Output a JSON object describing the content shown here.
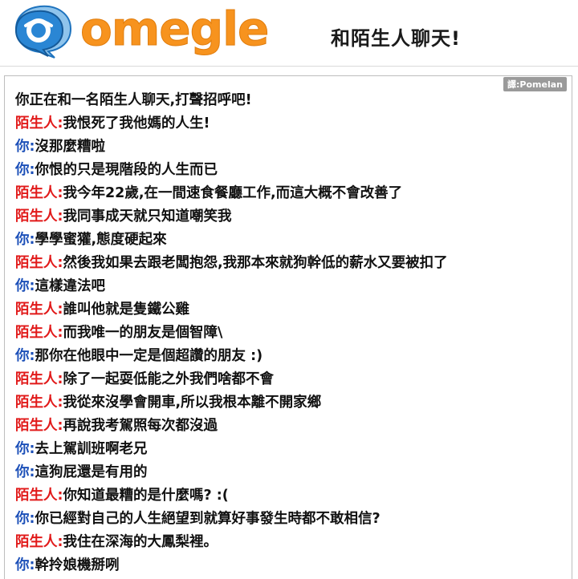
{
  "header": {
    "logo_text": "omegle",
    "tagline": "和陌生人聊天!"
  },
  "watermark": "譯:Pomelan",
  "chat": {
    "system_message": "你正在和一名陌生人聊天,打聲招呼吧!",
    "messages": [
      {
        "speaker": "陌生人:",
        "role": "stranger",
        "text": "我恨死了我他媽的人生!"
      },
      {
        "speaker": "你:",
        "role": "you",
        "text": "沒那麼糟啦"
      },
      {
        "speaker": "你:",
        "role": "you",
        "text": "你恨的只是現階段的人生而已"
      },
      {
        "speaker": "陌生人:",
        "role": "stranger",
        "text": "我今年22歲,在一間速食餐廳工作,而這大概不會改善了"
      },
      {
        "speaker": "陌生人:",
        "role": "stranger",
        "text": "我同事成天就只知道嘲笑我"
      },
      {
        "speaker": "你:",
        "role": "you",
        "text": "學學蜜獾,態度硬起來"
      },
      {
        "speaker": "陌生人:",
        "role": "stranger",
        "text": "然後我如果去跟老闆抱怨,我那本來就狗幹低的薪水又要被扣了"
      },
      {
        "speaker": "你:",
        "role": "you",
        "text": "這樣違法吧"
      },
      {
        "speaker": "陌生人:",
        "role": "stranger",
        "text": "誰叫他就是隻鐵公雞"
      },
      {
        "speaker": "陌生人:",
        "role": "stranger",
        "text": "而我唯一的朋友是個智障\\"
      },
      {
        "speaker": "你:",
        "role": "you",
        "text": "那你在他眼中一定是個超讚的朋友 :)"
      },
      {
        "speaker": "陌生人:",
        "role": "stranger",
        "text": "除了一起耍低能之外我們啥都不會"
      },
      {
        "speaker": "陌生人:",
        "role": "stranger",
        "text": "我從來沒學會開車,所以我根本離不開家鄉"
      },
      {
        "speaker": "陌生人:",
        "role": "stranger",
        "text": "再說我考駕照每次都沒過"
      },
      {
        "speaker": "你:",
        "role": "you",
        "text": "去上駕訓班啊老兄"
      },
      {
        "speaker": "你:",
        "role": "you",
        "text": "這狗屁還是有用的"
      },
      {
        "speaker": "陌生人:",
        "role": "stranger",
        "text": "你知道最糟的是什麼嗎? :("
      },
      {
        "speaker": "你:",
        "role": "you",
        "text": "你已經對自己的人生絕望到就算好事發生時都不敢相信?"
      },
      {
        "speaker": "陌生人:",
        "role": "stranger",
        "text": "我住在深海的大鳳梨裡。"
      },
      {
        "speaker": "你:",
        "role": "you",
        "text": "幹拎娘機掰咧"
      }
    ]
  },
  "colors": {
    "logo_orange": "#f7931e",
    "logo_blue": "#1e73be",
    "stranger_red": "#e11919",
    "you_blue": "#1b4fb8"
  }
}
